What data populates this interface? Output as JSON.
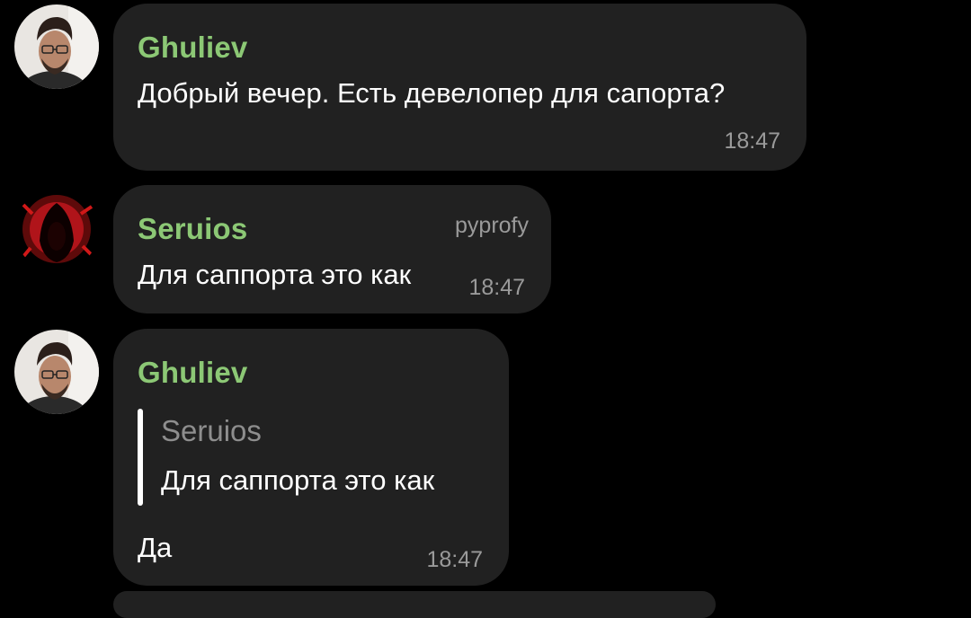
{
  "messages": [
    {
      "sender": "Ghuliev",
      "text": "Добрый вечер. Есть девелопер для сапорта?",
      "time": "18:47"
    },
    {
      "sender": "Seruios",
      "tag": "pyprofy",
      "text": "Для саппорта это как",
      "time": "18:47"
    },
    {
      "sender": "Ghuliev",
      "reply": {
        "sender": "Seruios",
        "text": "Для саппорта это как"
      },
      "text": "Да",
      "time": "18:47"
    }
  ],
  "colors": {
    "background": "#000000",
    "bubble": "#212121",
    "sender_name": "#8cc875",
    "timestamp": "#9a9a9a",
    "reply_bar": "#ffffff"
  },
  "icons": {
    "avatar_ghuliev": "user-photo-avatar",
    "avatar_seruios": "red-hooded-figure-avatar"
  }
}
